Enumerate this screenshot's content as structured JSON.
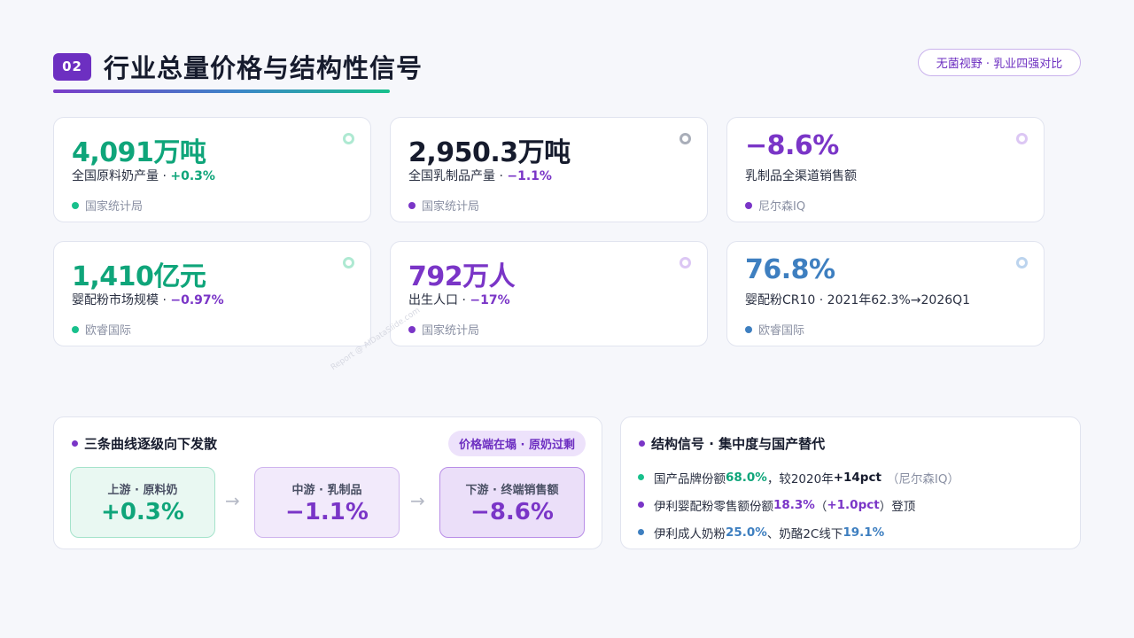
{
  "header": {
    "section_number": "02",
    "title": "行业总量价格与结构性信号",
    "tag": "无菌视野 · 乳业四强对比"
  },
  "cards": [
    {
      "value": "4,091万吨",
      "label": "全国原料奶产量",
      "sep": " · ",
      "change": "+0.3%",
      "source": "国家统计局"
    },
    {
      "value": "2,950.3万吨",
      "label": "全国乳制品产量",
      "sep": " · ",
      "change": "−1.1%",
      "source": "国家统计局"
    },
    {
      "value": "−8.6%",
      "label": "乳制品全渠道销售额",
      "sep": "",
      "change": "",
      "source": "尼尔森IQ"
    },
    {
      "value": "1,410亿元",
      "label": "婴配粉市场规模",
      "sep": " · ",
      "change": "−0.97%",
      "source": "欧睿国际"
    },
    {
      "value": "792万人",
      "label": "出生人口",
      "sep": " · ",
      "change": "−17%",
      "source": "国家统计局"
    },
    {
      "value": "76.8%",
      "label": "婴配粉CR10 · 2021年62.3%→2026Q1",
      "sep": "",
      "change": "",
      "source": "欧睿国际"
    }
  ],
  "divergence": {
    "title": "三条曲线逐级向下发散",
    "pill": "价格端在塌 · 原奶过剩",
    "stages": [
      {
        "label": "上游 · 原料奶",
        "value": "+0.3%"
      },
      {
        "label": "中游 · 乳制品",
        "value": "−1.1%"
      },
      {
        "label": "下游 · 终端销售额",
        "value": "−8.6%"
      }
    ],
    "arrow": "→"
  },
  "signals": {
    "title": "结构信号 · 集中度与国产替代",
    "items": [
      {
        "a": "国产品牌份额 ",
        "v1": "68.0%",
        "b": "，较2020年 ",
        "v2": "+14pct",
        "c": "（尼尔森IQ）"
      },
      {
        "a": "伊利婴配粉零售额份额 ",
        "v1": "18.3%",
        "b": "（",
        "v2": "+1.0pct",
        "c": "）登顶"
      },
      {
        "a": "伊利成人奶粉 ",
        "v1": "25.0%",
        "b": "、奶酪2C线下 ",
        "v2": "19.1%",
        "c": ""
      }
    ]
  },
  "watermark": "Report @ AIDataSlide.com",
  "colors": {
    "green": "#0fa57a",
    "navy": "#161b2d",
    "purple": "#7a35c7",
    "blue": "#3e7fc0",
    "accent": "#6d2fc1"
  }
}
